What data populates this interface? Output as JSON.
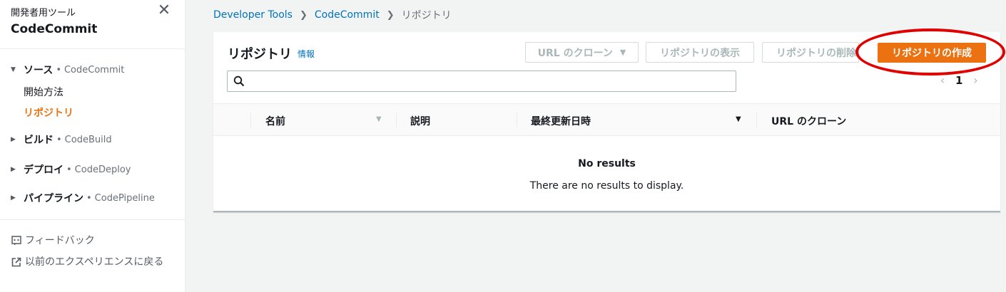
{
  "sidebar": {
    "service_label": "開発者用ツール",
    "title": "CodeCommit",
    "sections": [
      {
        "name": "ソース",
        "sub": "CodeCommit",
        "expanded": true
      },
      {
        "name": "ビルド",
        "sub": "CodeBuild",
        "expanded": false
      },
      {
        "name": "デプロイ",
        "sub": "CodeDeploy",
        "expanded": false
      },
      {
        "name": "パイプライン",
        "sub": "CodePipeline",
        "expanded": false
      }
    ],
    "source_links": [
      "開始方法",
      "リポジトリ"
    ],
    "active_link": "リポジトリ",
    "footer": {
      "feedback": "フィードバック",
      "previous_experience": "以前のエクスペリエンスに戻る"
    },
    "bullet": "•"
  },
  "breadcrumb": {
    "items": [
      "Developer Tools",
      "CodeCommit"
    ],
    "current": "リポジトリ"
  },
  "panel": {
    "title": "リポジトリ",
    "info": "情報",
    "buttons": {
      "clone_url": "URL のクローン",
      "view": "リポジトリの表示",
      "delete": "リポジトリの削除",
      "create": "リポジトリの作成"
    },
    "search": {
      "placeholder": "",
      "value": ""
    },
    "pagination": {
      "current_page": "1"
    }
  },
  "table": {
    "columns": [
      "名前",
      "説明",
      "最終更新日時",
      "URL のクローン"
    ],
    "empty_title": "No results",
    "empty_message": "There are no results to display."
  },
  "colors": {
    "primary": "#ec7211",
    "link": "#0073bb",
    "highlight_ring": "#e00000"
  },
  "icons": {
    "close": "close-icon",
    "search": "search-icon",
    "feedback": "feedback-icon",
    "external": "external-link-icon"
  }
}
